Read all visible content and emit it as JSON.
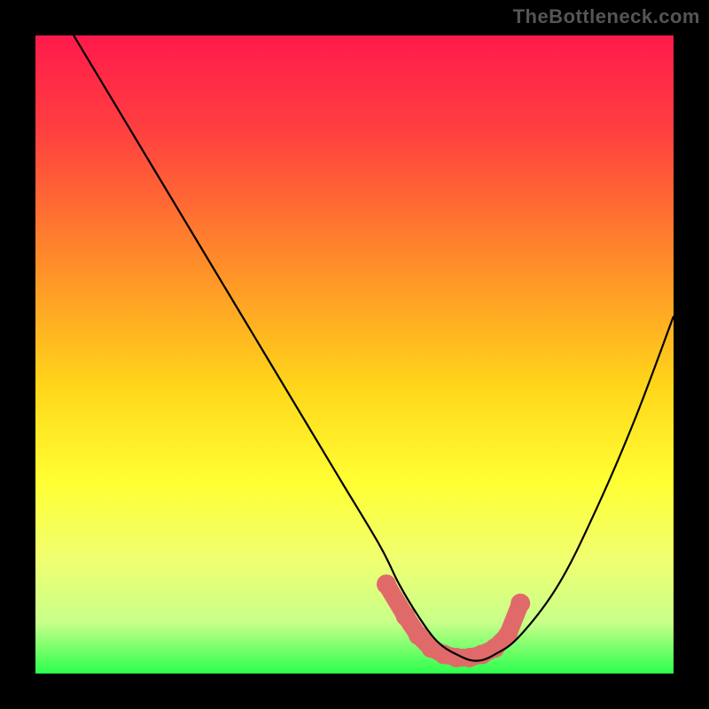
{
  "watermark": "TheBottleneck.com",
  "chart_data": {
    "type": "line",
    "title": "",
    "xlabel": "",
    "ylabel": "",
    "xlim": [
      0,
      100
    ],
    "ylim": [
      0,
      100
    ],
    "grid": false,
    "legend": false,
    "gradient_stops": [
      {
        "pct": 0,
        "color": "#ff1a4b"
      },
      {
        "pct": 15,
        "color": "#ff4040"
      },
      {
        "pct": 35,
        "color": "#ff8a2a"
      },
      {
        "pct": 55,
        "color": "#ffd61a"
      },
      {
        "pct": 70,
        "color": "#ffff33"
      },
      {
        "pct": 82,
        "color": "#f0ff70"
      },
      {
        "pct": 92,
        "color": "#c8ff8a"
      },
      {
        "pct": 100,
        "color": "#2bff4d"
      }
    ],
    "series": [
      {
        "name": "curve",
        "x": [
          6,
          12,
          18,
          24,
          30,
          36,
          42,
          48,
          54,
          57,
          60,
          63,
          66,
          69,
          72,
          76,
          82,
          88,
          94,
          100
        ],
        "y": [
          100,
          90,
          80,
          70,
          60,
          50,
          40,
          30,
          20,
          14,
          9,
          5,
          3,
          2,
          3,
          6,
          14,
          26,
          40,
          56
        ]
      }
    ],
    "markers": {
      "name": "bottom-highlight",
      "color": "#e06a6a",
      "points": [
        {
          "x": 55,
          "y": 14
        },
        {
          "x": 58,
          "y": 9
        },
        {
          "x": 60,
          "y": 6
        },
        {
          "x": 62,
          "y": 4
        },
        {
          "x": 64,
          "y": 3
        },
        {
          "x": 66,
          "y": 2.5
        },
        {
          "x": 68,
          "y": 2.5
        },
        {
          "x": 70,
          "y": 3
        },
        {
          "x": 72,
          "y": 4
        },
        {
          "x": 74,
          "y": 6
        },
        {
          "x": 76,
          "y": 11
        }
      ]
    }
  }
}
